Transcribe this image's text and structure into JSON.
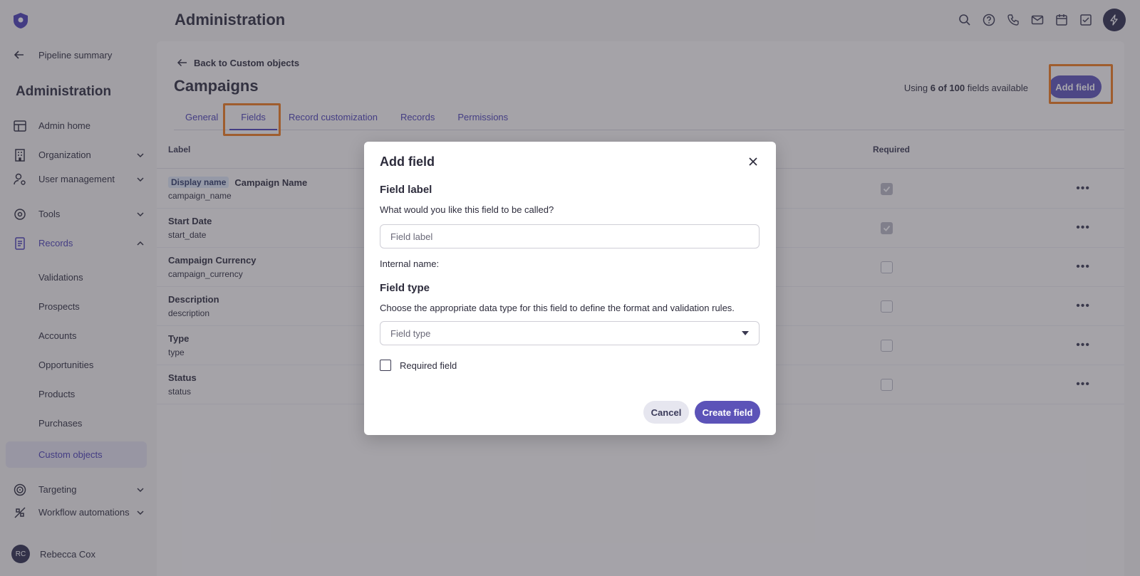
{
  "app": {
    "title": "Administration"
  },
  "sidebar": {
    "back_label": "Pipeline summary",
    "title": "Administration",
    "nav": [
      {
        "label": "Admin home"
      },
      {
        "label": "Organization"
      },
      {
        "label": "User management"
      },
      {
        "label": "Tools"
      },
      {
        "label": "Records"
      },
      {
        "label": "Targeting"
      },
      {
        "label": "Workflow automations"
      }
    ],
    "records_sub": [
      "Validations",
      "Prospects",
      "Accounts",
      "Opportunities",
      "Products",
      "Purchases",
      "Custom objects"
    ],
    "user": {
      "initials": "RC",
      "name": "Rebecca Cox"
    }
  },
  "page": {
    "back_link": "Back to Custom objects",
    "title": "Campaigns",
    "usage_prefix": "Using ",
    "usage_count": "6 of 100",
    "usage_suffix": " fields available",
    "add_field": "Add field",
    "tabs": [
      "General",
      "Fields",
      "Record customization",
      "Records",
      "Permissions"
    ],
    "active_tab": "Fields"
  },
  "table": {
    "col_label": "Label",
    "col_required": "Required",
    "rows": [
      {
        "badge": "Display name",
        "name": "Campaign Name",
        "key": "campaign_name",
        "required": true
      },
      {
        "badge": "",
        "name": "Start Date",
        "key": "start_date",
        "required": true
      },
      {
        "badge": "",
        "name": "Campaign Currency",
        "key": "campaign_currency",
        "required": false
      },
      {
        "badge": "",
        "name": "Description",
        "key": "description",
        "required": false
      },
      {
        "badge": "",
        "name": "Type",
        "key": "type",
        "required": false
      },
      {
        "badge": "",
        "name": "Status",
        "key": "status",
        "required": false
      }
    ],
    "more": "•••"
  },
  "modal": {
    "title": "Add field",
    "field_label_heading": "Field label",
    "field_label_help": "What would you like this field to be called?",
    "field_label_placeholder": "Field label",
    "internal_name": "Internal name:",
    "field_type_heading": "Field type",
    "field_type_help": "Choose the appropriate data type for this field to define the format and validation rules.",
    "field_type_placeholder": "Field type",
    "required_label": "Required field",
    "cancel": "Cancel",
    "create": "Create field"
  },
  "colors": {
    "accent": "#5c53b8",
    "highlight": "#f07a1a"
  }
}
